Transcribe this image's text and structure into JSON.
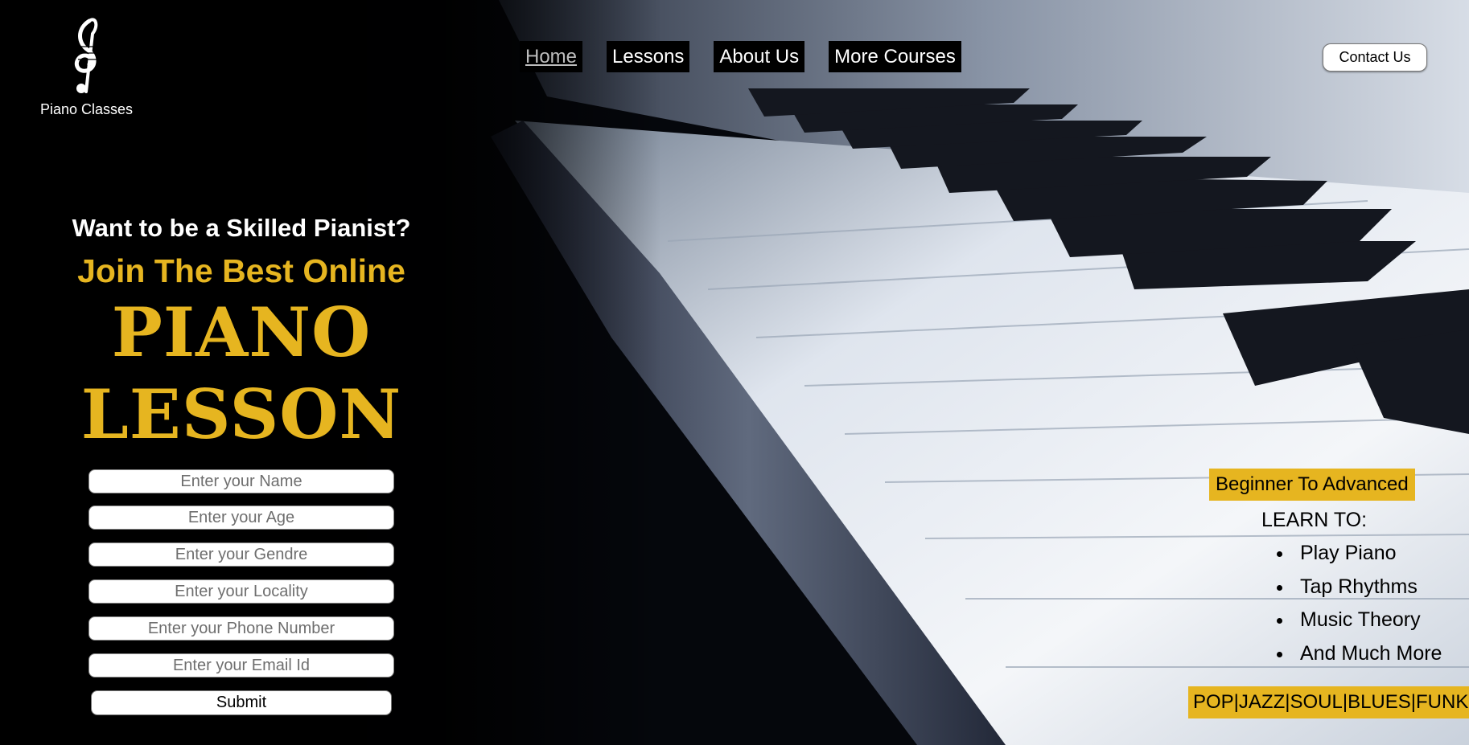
{
  "brand": {
    "name": "Piano Classes",
    "logo_icon": "treble-clef-icon"
  },
  "nav": {
    "items": [
      {
        "label": "Home",
        "active": true
      },
      {
        "label": "Lessons",
        "active": false
      },
      {
        "label": "About Us",
        "active": false
      },
      {
        "label": "More Courses",
        "active": false
      }
    ]
  },
  "contact": {
    "label": "Contact Us"
  },
  "hero": {
    "question": "Want to be a Skilled Pianist?",
    "join": "Join The Best Online",
    "title_line1": "PIANO",
    "title_line2": "LESSON"
  },
  "form": {
    "placeholders": [
      "Enter your Name",
      "Enter your Age",
      "Enter your Gendre",
      "Enter your Locality",
      "Enter your Phone Number",
      "Enter your Email Id"
    ],
    "submit_label": "Submit"
  },
  "learn": {
    "badge": "Beginner To Advanced",
    "title": "LEARN TO:",
    "items": [
      "Play Piano",
      "Tap Rhythms",
      "Music Theory",
      "And Much More"
    ],
    "genres": "POP|JAZZ|SOUL|BLUES|FUNK"
  },
  "colors": {
    "accent": "#e6b520",
    "background": "#000000",
    "text_light": "#ffffff"
  }
}
